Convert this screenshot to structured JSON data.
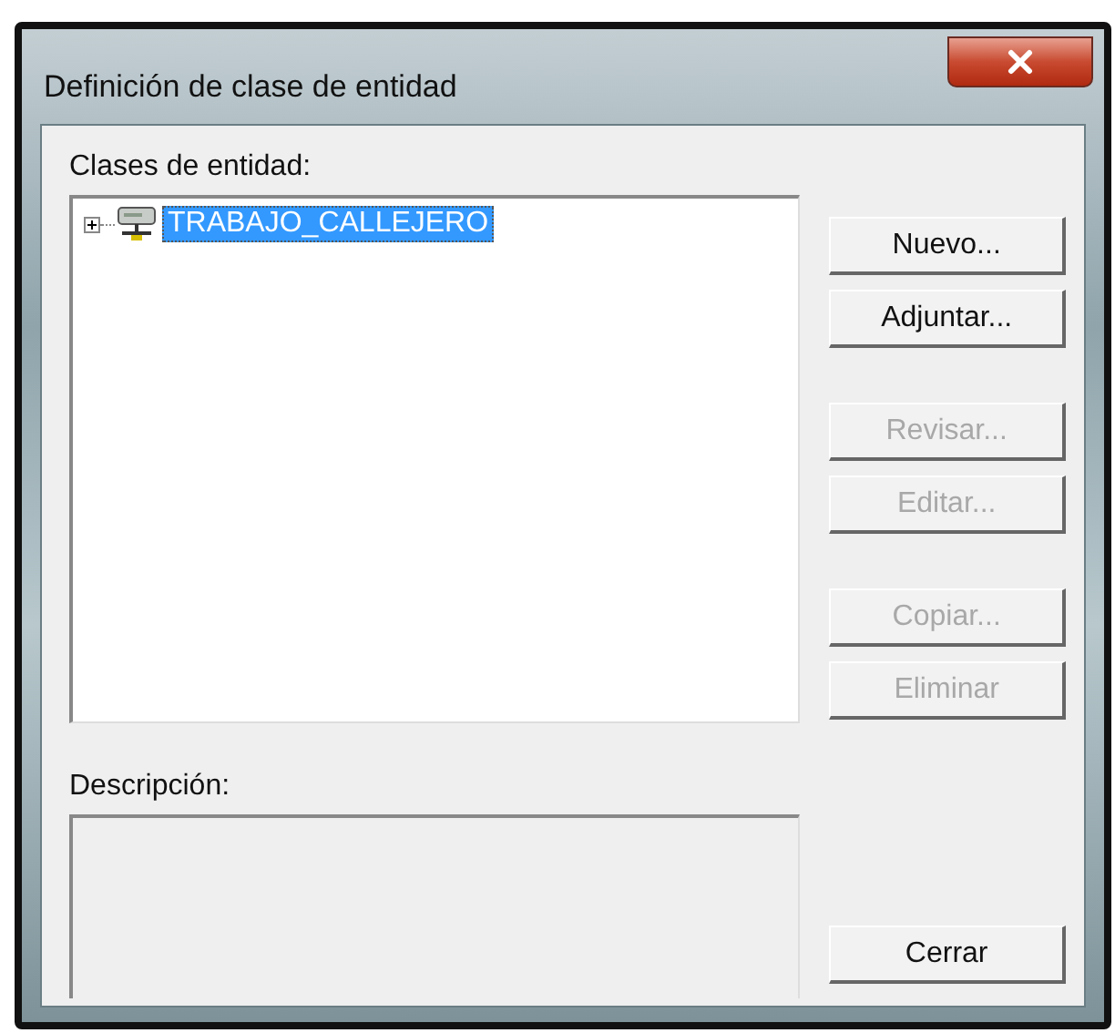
{
  "window": {
    "title": "Definición de clase de entidad"
  },
  "classes": {
    "label": "Clases de entidad:",
    "tree": [
      {
        "label": "TRABAJO_CALLEJERO",
        "expanded": false,
        "selected": true
      }
    ]
  },
  "button_groups": [
    [
      {
        "label": "Nuevo...",
        "disabled": false
      },
      {
        "label": "Adjuntar...",
        "disabled": false
      }
    ],
    [
      {
        "label": "Revisar...",
        "disabled": true
      },
      {
        "label": "Editar...",
        "disabled": true
      }
    ],
    [
      {
        "label": "Copiar...",
        "disabled": true
      },
      {
        "label": "Eliminar",
        "disabled": true
      }
    ]
  ],
  "description": {
    "label": "Descripción:"
  },
  "close_button": "Cerrar"
}
